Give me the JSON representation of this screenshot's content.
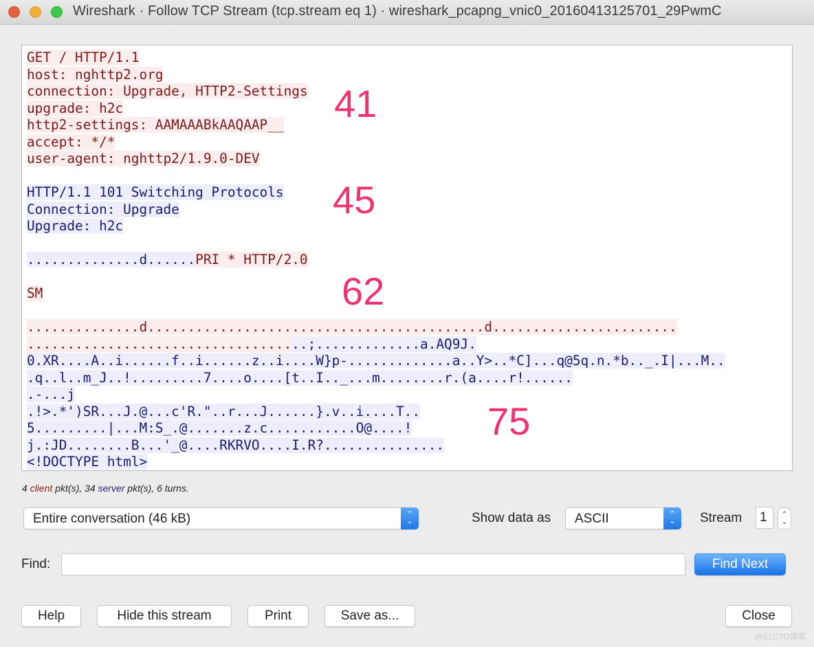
{
  "window": {
    "title": "Wireshark · Follow TCP Stream (tcp.stream eq 1) · wireshark_pcapng_vnic0_20160413125701_29PwmC",
    "controls": [
      "close",
      "minimize",
      "maximize"
    ]
  },
  "stream": {
    "lines": [
      {
        "segments": [
          {
            "dir": "client",
            "text": "GET / HTTP/1.1"
          }
        ]
      },
      {
        "segments": [
          {
            "dir": "client",
            "text": "host: nghttp2.org"
          }
        ]
      },
      {
        "segments": [
          {
            "dir": "client",
            "text": "connection: Upgrade, HTTP2-Settings"
          }
        ]
      },
      {
        "segments": [
          {
            "dir": "client",
            "text": "upgrade: h2c"
          }
        ]
      },
      {
        "segments": [
          {
            "dir": "client",
            "text": "http2-settings: AAMAAABkAAQAAP__"
          }
        ]
      },
      {
        "segments": [
          {
            "dir": "client",
            "text": "accept: */*"
          }
        ]
      },
      {
        "segments": [
          {
            "dir": "client",
            "text": "user-agent: nghttp2/1.9.0-DEV"
          }
        ]
      },
      {
        "segments": []
      },
      {
        "segments": [
          {
            "dir": "server",
            "text": "HTTP/1.1 101 Switching Protocols"
          }
        ]
      },
      {
        "segments": [
          {
            "dir": "server",
            "text": "Connection: Upgrade"
          }
        ]
      },
      {
        "segments": [
          {
            "dir": "server",
            "text": "Upgrade: h2c"
          }
        ]
      },
      {
        "segments": []
      },
      {
        "segments": [
          {
            "dir": "server",
            "text": "..............d......"
          },
          {
            "dir": "client",
            "text": "PRI * HTTP/2.0"
          }
        ]
      },
      {
        "segments": []
      },
      {
        "segments": [
          {
            "dir": "client",
            "text": "SM"
          }
        ]
      },
      {
        "segments": []
      },
      {
        "segments": [
          {
            "dir": "client",
            "text": "..............d..........................................d......................."
          }
        ]
      },
      {
        "segments": [
          {
            "dir": "client",
            "text": "................................."
          },
          {
            "dir": "server",
            "text": "..;.............a.AQ9J."
          }
        ]
      },
      {
        "segments": [
          {
            "dir": "server",
            "text": "0.XR....A..i......f..i......z..i....W}p-.............a..Y>..*C]...q@5q.n.*b.._.I|...M.."
          }
        ]
      },
      {
        "segments": [
          {
            "dir": "server",
            "text": ".q..l..m_J..!.........7....o....[t..I.._...m........r.(a....r!......"
          }
        ]
      },
      {
        "segments": [
          {
            "dir": "server",
            "text": ".-...j"
          }
        ]
      },
      {
        "segments": [
          {
            "dir": "server",
            "text": ".!>.*')SR...J.@...c'R.\"..r...J......}.v..i....T.."
          }
        ]
      },
      {
        "segments": [
          {
            "dir": "server",
            "text": "5.........|...M:S_.@.......z.c...........O@....!"
          }
        ]
      },
      {
        "segments": [
          {
            "dir": "server",
            "text": "j.:JD........B...'_@....RKRVO....I.R?..............."
          }
        ]
      },
      {
        "segments": [
          {
            "dir": "server",
            "text": "<!DOCTYPE html>"
          }
        ]
      }
    ],
    "annotations": [
      "41",
      "45",
      "62",
      "75"
    ]
  },
  "summary": {
    "client_count": "4",
    "client_word": "client",
    "mid_text": " pkt(s), ",
    "server_count": "34",
    "server_word": "server",
    "tail_text": " pkt(s), 6 turns."
  },
  "controls": {
    "conversation_select": "Entire conversation (46 kB)",
    "show_data_label": "Show data as",
    "show_data_select": "ASCII",
    "stream_label": "Stream",
    "stream_value": "1",
    "find_label": "Find:",
    "find_value": "",
    "find_next": "Find Next"
  },
  "buttons": {
    "help": "Help",
    "hide_stream": "Hide this stream",
    "print": "Print",
    "save_as": "Save as...",
    "close": "Close"
  },
  "watermark": "@51CTO博客",
  "colors": {
    "client_text": "#7a1a1a",
    "client_bg": "#fbeded",
    "server_text": "#1c1c6e",
    "server_bg": "#ededfb",
    "annotation": "#ee3370",
    "accent": "#1a73e8"
  }
}
